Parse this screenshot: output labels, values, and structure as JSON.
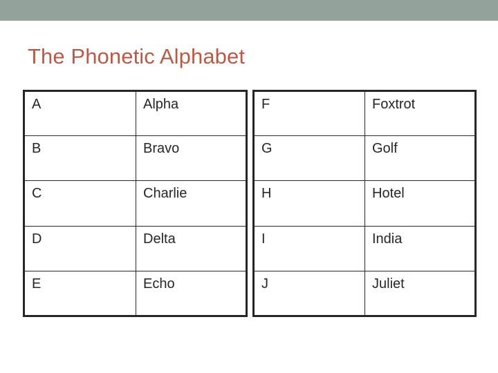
{
  "slide": {
    "title": "The Phonetic Alphabet",
    "title_color": "#b85a45",
    "band_color": "#93a39a",
    "background_color": "#ffffff",
    "border_color": "#262626",
    "text_color": "#262626"
  },
  "tables": [
    {
      "id": "table-left",
      "rows": [
        {
          "letter": "A",
          "word": "Alpha"
        },
        {
          "letter": "B",
          "word": "Bravo"
        },
        {
          "letter": "C",
          "word": "Charlie"
        },
        {
          "letter": "D",
          "word": "Delta"
        },
        {
          "letter": "E",
          "word": "Echo"
        }
      ]
    },
    {
      "id": "table-right",
      "rows": [
        {
          "letter": "F",
          "word": "Foxtrot"
        },
        {
          "letter": "G",
          "word": "Golf"
        },
        {
          "letter": "H",
          "word": "Hotel"
        },
        {
          "letter": "I",
          "word": "India"
        },
        {
          "letter": "J",
          "word": "Juliet"
        }
      ]
    }
  ]
}
